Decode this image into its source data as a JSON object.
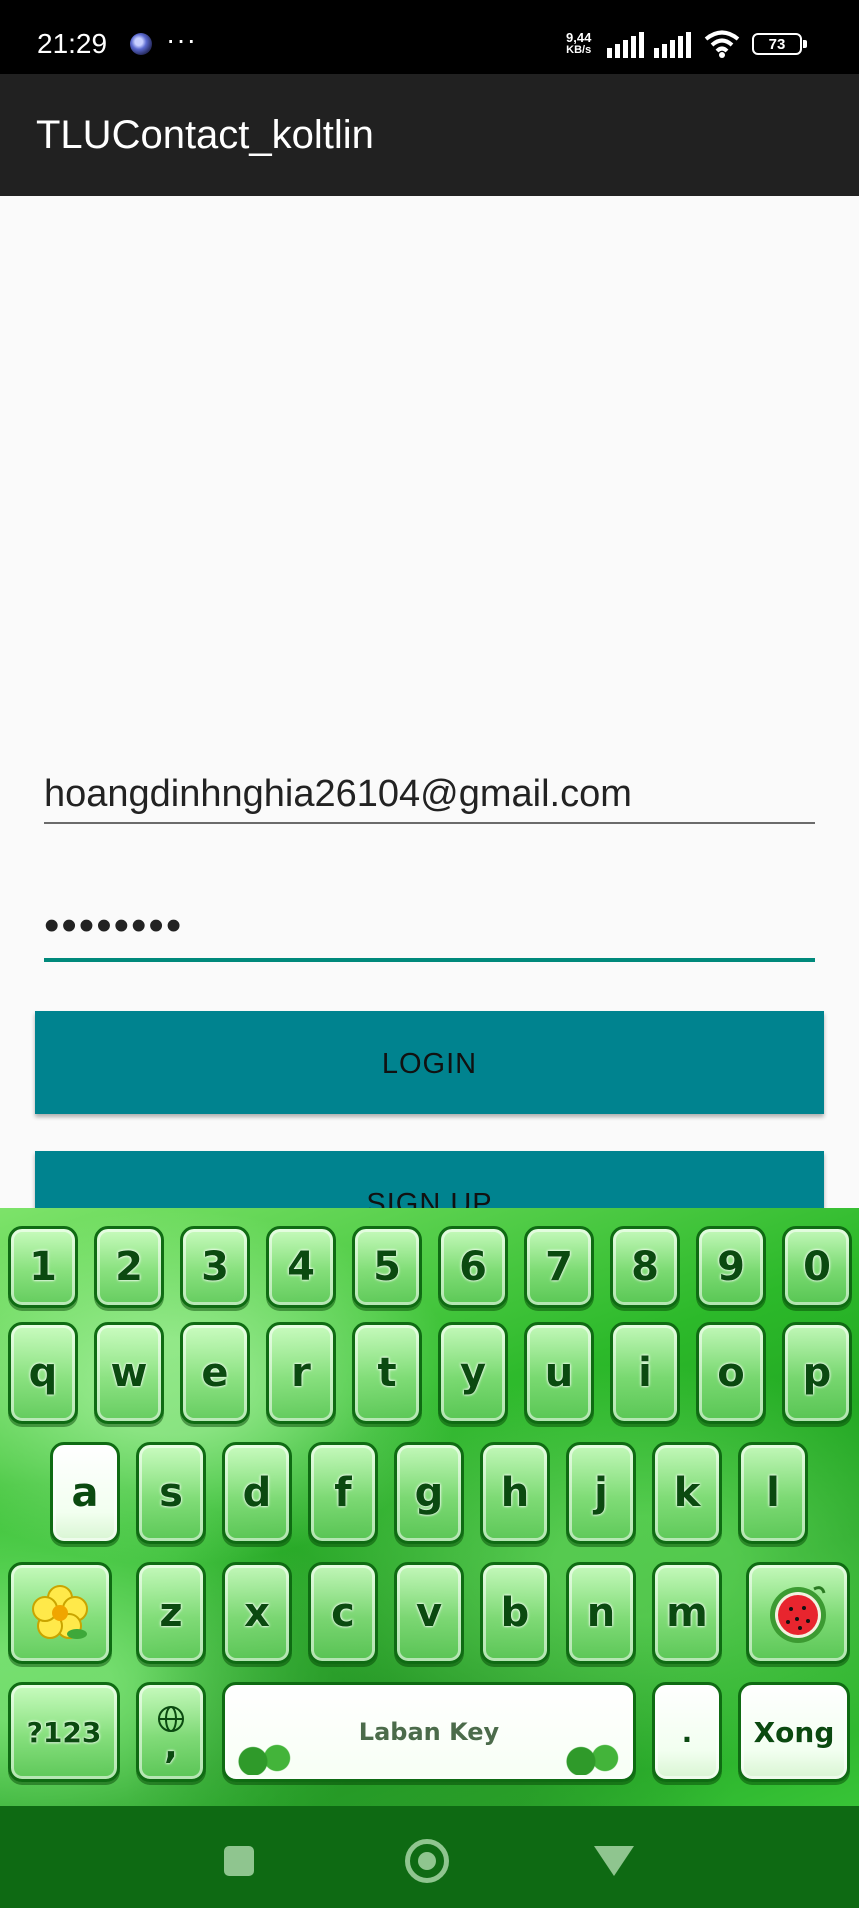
{
  "status_bar": {
    "time": "21:29",
    "dots": "···",
    "net_speed_value": "9,44",
    "net_speed_unit": "KB/s",
    "battery": "73"
  },
  "app_bar": {
    "title": "TLUContact_koltlin"
  },
  "form": {
    "email_value": "hoangdinhnghia26104@gmail.com",
    "password_value": "••••••••",
    "login_label": "LOGIN",
    "signup_label": "SIGN UP"
  },
  "keyboard": {
    "number_row": [
      "1",
      "2",
      "3",
      "4",
      "5",
      "6",
      "7",
      "8",
      "9",
      "0"
    ],
    "row1": [
      "q",
      "w",
      "e",
      "r",
      "t",
      "y",
      "u",
      "i",
      "o",
      "p"
    ],
    "row2": [
      "a",
      "s",
      "d",
      "f",
      "g",
      "h",
      "j",
      "k",
      "l"
    ],
    "row3": [
      "z",
      "x",
      "c",
      "v",
      "b",
      "n",
      "m"
    ],
    "symbols_label": "?123",
    "comma_label": ",",
    "space_label": "Laban Key",
    "period_label": ".",
    "done_label": "Xong"
  },
  "colors": {
    "accent": "#00838f",
    "underline_focus": "#00897b",
    "appbar": "#212121",
    "nav": "#0e6a13"
  },
  "icons": [
    "notification-icon",
    "signal-icon",
    "wifi-icon",
    "battery-icon",
    "flower-icon",
    "watermelon-icon",
    "globe-icon",
    "recents-icon",
    "home-icon",
    "back-icon"
  ]
}
